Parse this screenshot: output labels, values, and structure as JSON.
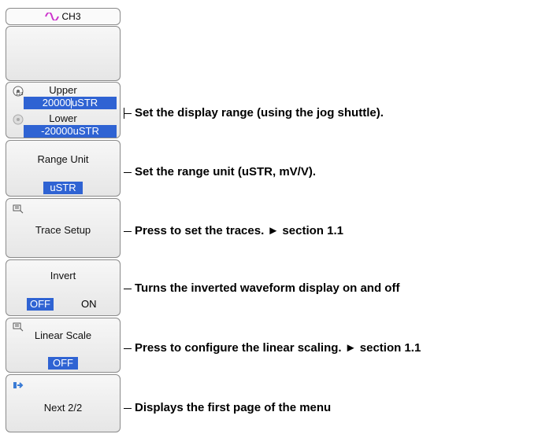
{
  "channel": {
    "label": "CH3"
  },
  "keys": {
    "upper_label": "Upper",
    "upper_value_prefix": "20000",
    "upper_value_highlight": "uSTR",
    "lower_label": "Lower",
    "lower_value": "-20000uSTR",
    "range_unit_label": "Range Unit",
    "range_unit_value": "uSTR",
    "trace_setup_label": "Trace Setup",
    "invert_label": "Invert",
    "invert_off": "OFF",
    "invert_on": "ON",
    "linear_scale_label": "Linear Scale",
    "linear_scale_value": "OFF",
    "next_label": "Next 2/2"
  },
  "callouts": {
    "display_range": "Set the display range (using the jog shuttle).",
    "range_unit": "Set the range unit (uSTR, mV/V).",
    "trace_setup": "Press to set the traces. ► section 1.1",
    "invert": "Turns the inverted waveform display on and off",
    "linear_scale": "Press to configure the linear scaling. ► section 1.1",
    "next": "Displays the first page of the menu"
  },
  "colors": {
    "accent": "#2f63d3",
    "wave": "#cc33cc"
  },
  "icons": {
    "channel": "sine-wave-icon",
    "jog": "jog-dial-icon",
    "sub_menu": "sub-menu-icon",
    "next": "next-page-icon"
  }
}
